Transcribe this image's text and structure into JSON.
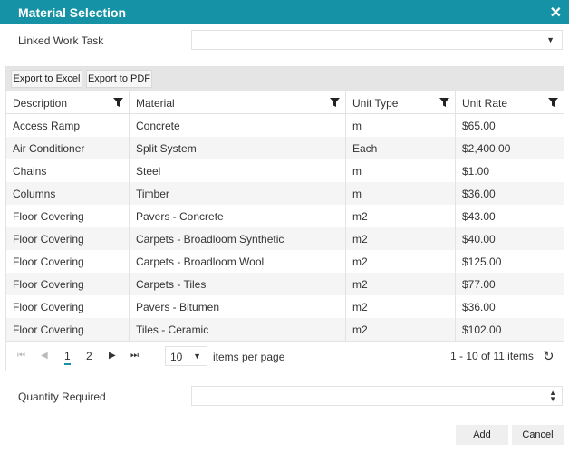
{
  "dialog": {
    "title": "Material Selection",
    "close_glyph": "✕"
  },
  "linked_work_task": {
    "label": "Linked Work Task",
    "value": ""
  },
  "toolbar": {
    "export_excel": "Export to Excel",
    "export_pdf": "Export to PDF"
  },
  "columns": [
    "Description",
    "Material",
    "Unit Type",
    "Unit Rate"
  ],
  "rows": [
    [
      "Access Ramp",
      "Concrete",
      "m",
      "$65.00"
    ],
    [
      "Air Conditioner",
      "Split System",
      "Each",
      "$2,400.00"
    ],
    [
      "Chains",
      "Steel",
      "m",
      "$1.00"
    ],
    [
      "Columns",
      "Timber",
      "m",
      "$36.00"
    ],
    [
      "Floor Covering",
      "Pavers - Concrete",
      "m2",
      "$43.00"
    ],
    [
      "Floor Covering",
      "Carpets - Broadloom Synthetic",
      "m2",
      "$40.00"
    ],
    [
      "Floor Covering",
      "Carpets - Broadloom Wool",
      "m2",
      "$125.00"
    ],
    [
      "Floor Covering",
      "Carpets - Tiles",
      "m2",
      "$77.00"
    ],
    [
      "Floor Covering",
      "Pavers - Bitumen",
      "m2",
      "$36.00"
    ],
    [
      "Floor Covering",
      "Tiles - Ceramic",
      "m2",
      "$102.00"
    ]
  ],
  "pager": {
    "pages": [
      "1",
      "2"
    ],
    "current_page": "1",
    "page_size": "10",
    "items_per_page_label": "items per page",
    "info": "1 - 10 of 11 items"
  },
  "quantity": {
    "label": "Quantity Required",
    "value": ""
  },
  "buttons": {
    "add": "Add",
    "cancel": "Cancel"
  },
  "colors": {
    "accent": "#1592a5",
    "alt_row": "#f5f5f5",
    "toolbar": "#e5e5e5"
  }
}
